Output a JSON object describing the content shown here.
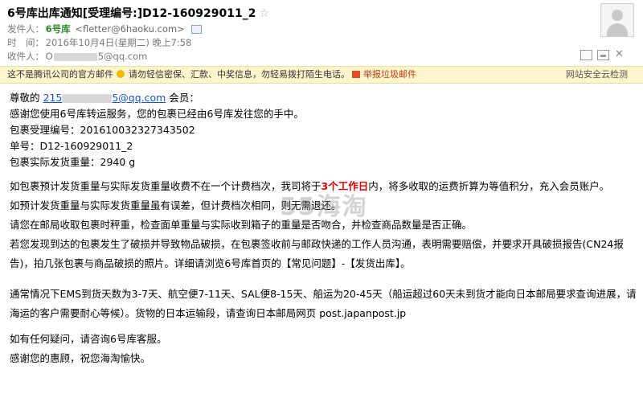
{
  "header": {
    "subject": "6号库出库通知[受理编号:]D12-160929011_2",
    "star": "☆",
    "from_label": "发件人：",
    "from_name": "6号库",
    "from_addr": "<fletter@6haoku.com>",
    "time_label": "时　间：",
    "time_value": "2016年10月4日(星期二) 晚上7:58",
    "to_label": "收件人：",
    "to_prefix": "O",
    "to_suffix": "5@qq.com"
  },
  "warnbar": {
    "official": "这不是腾讯公司的官方邮件",
    "tip": "请勿轻信密保、汇款、中奖信息，勿轻易拨打陌生电话。",
    "report": "举报垃圾邮件",
    "safety": "网站安全云检测"
  },
  "body": {
    "greeting_prefix": "尊敬的",
    "email_prefix": "215",
    "email_suffix": "5@qq.com",
    "greeting_suffix": "会员：",
    "line1": "感谢您使用6号库转运服务，您的包裹已经由6号库发往您的手中。",
    "line2": "包裹受理编号：201610032327343502",
    "line3": "单号：D12-160929011_2",
    "line4": "包裹实际发货重量：2940 g",
    "line5_pre": "如包裹预计发货重量与实际发货重量收费不在一个计费档次，我司将于",
    "line5_red": "3个工作日",
    "line5_post": "内，将多收取的运费折算为等值积分，充入会员账户。",
    "line6": "如预计发货重量与实际发货重量虽有误差，但计费档次相同，则无需退还。",
    "line7": "请您在邮局收取包裹时秤重，检查面单重量与实际收到箱子的重量是否吻合，并检查商品数量是否正确。",
    "line8": "若您发现到达的包裹发生了破损并导致物品破损，在包裹签收前与邮政快递的工作人员沟通，表明需要赔偿，并要求开具破损报告(CN24报告)，拍几张包裹与商品破损的照片。详细请浏览6号库首页的【常见问题】-【发货出库】。",
    "line9": "通常情况下EMS到货天数为3-7天、航空便7-11天、SAL便8-15天、船运为20-45天（船运超过60天未到货才能向日本邮局要求查询进展，请海运的客户需要耐心等候）。货物的日本运输段，请查询日本邮局网页 post.japanpost.jp",
    "line10": "如有任何疑问，请咨询6号库客服。",
    "line11": "感谢您的惠顾，祝您海淘愉快。"
  },
  "watermark": "55海淘"
}
